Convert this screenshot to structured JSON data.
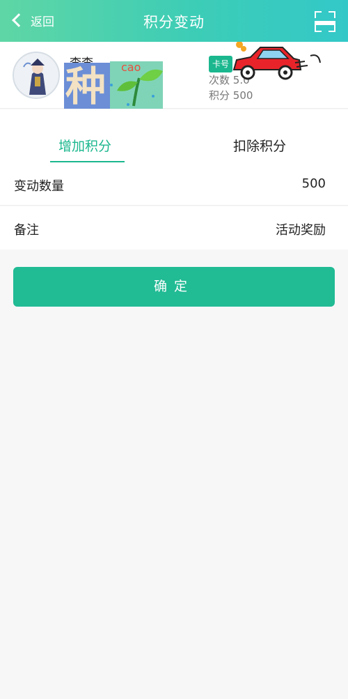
{
  "nav": {
    "back_label": "返回",
    "title": "积分变动"
  },
  "member": {
    "name": "李李",
    "card_tag": "卡号",
    "visits_label": "次数",
    "visits_value": "5.0",
    "points_label": "积分",
    "points_value": "500"
  },
  "sticker": {
    "char": "种",
    "caption": "cao"
  },
  "tabs": [
    {
      "label": "增加积分",
      "active": true
    },
    {
      "label": "扣除积分",
      "active": false
    }
  ],
  "form": {
    "amount_label": "变动数量",
    "amount_value": "500",
    "remark_label": "备注",
    "remark_value": "活动奖励"
  },
  "confirm_label": "确定",
  "colors": {
    "accent": "#1bb78e",
    "nav_start": "#5fd6a5",
    "nav_end": "#33c8c8"
  }
}
